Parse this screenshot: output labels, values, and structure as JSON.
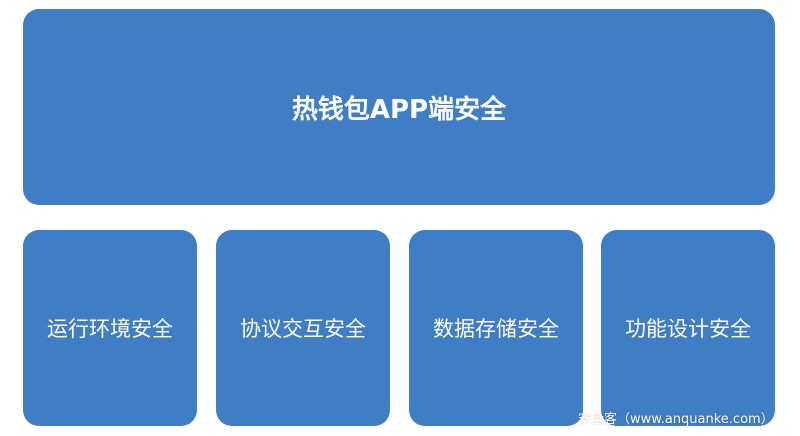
{
  "diagram": {
    "title": "热钱包APP端安全",
    "boxes": [
      "运行环境安全",
      "协议交互安全",
      "数据存储安全",
      "功能设计安全"
    ]
  },
  "watermark": "安全客（www.anquanke.com）",
  "colors": {
    "box_fill": "#3f7dc4",
    "text": "#ffffff",
    "background": "#ffffff"
  }
}
